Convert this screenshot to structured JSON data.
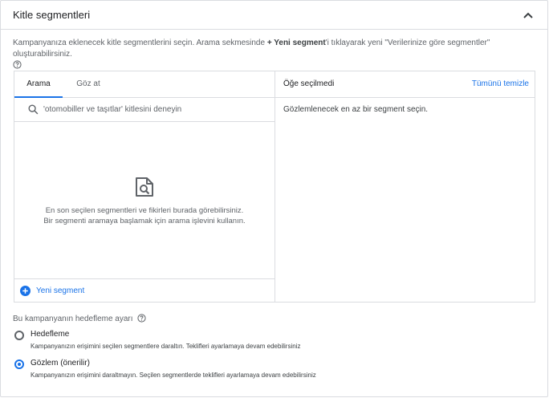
{
  "header": {
    "title": "Kitle segmentleri",
    "chevron_icon": "chevron-up-icon"
  },
  "description": {
    "before": "Kampanyanıza eklenecek kitle segmentlerini seçin. Arama sekmesinde ",
    "bold": "+ Yeni segment",
    "after": "'i tıklayarak yeni \"Verilerinize göre segmentler\" oluşturabilirsiniz."
  },
  "browser": {
    "tabs": [
      {
        "label": "Arama",
        "active": true
      },
      {
        "label": "Göz at",
        "active": false
      }
    ],
    "search": {
      "value": "",
      "placeholder": "'otomobiller ve taşıtlar' kitlesini deneyin"
    },
    "empty_line1": "En son seçilen segmentleri ve fikirleri burada görebilirsiniz.",
    "empty_line2": "Bir segmenti aramaya başlamak için arama işlevini kullanın.",
    "new_segment_label": "Yeni segment"
  },
  "selected": {
    "none_label": "Öğe seçilmedi",
    "clear_all_label": "Tümünü temizle",
    "hint": "Gözlemlenecek en az bir segment seçin."
  },
  "targeting": {
    "title": "Bu kampanyanın hedefleme ayarı",
    "options": [
      {
        "label": "Hedefleme",
        "description": "Kampanyanızın erişimini seçilen segmentlere daraltın. Teklifleri ayarlamaya devam edebilirsiniz",
        "selected": false
      },
      {
        "label": "Gözlem (önerilir)",
        "description": "Kampanyanızın erişimini daraltmayın. Seçilen segmentlerde teklifleri ayarlamaya devam edebilirsiniz",
        "selected": true
      }
    ]
  },
  "colors": {
    "accent": "#1a73e8",
    "border": "#dadce0",
    "text": "#3c4043"
  }
}
